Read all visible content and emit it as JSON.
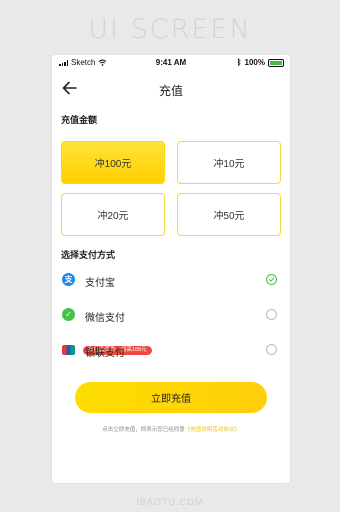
{
  "watermark": {
    "title": "UI SCREEN",
    "url": "IBAOTU.COM"
  },
  "status_bar": {
    "carrier": "Sketch",
    "time": "9:41 AM",
    "battery": "100%"
  },
  "nav": {
    "title": "充值"
  },
  "amount_section": {
    "label": "充值金额",
    "options": [
      {
        "label": "冲100元",
        "selected": true
      },
      {
        "label": "冲10元",
        "selected": false
      },
      {
        "label": "冲20元",
        "selected": false
      },
      {
        "label": "冲50元",
        "selected": false
      }
    ]
  },
  "payment_section": {
    "label": "选择支付方式",
    "methods": [
      {
        "label": "支付宝",
        "icon": "alipay-icon",
        "checked": true
      },
      {
        "label": "微信支付",
        "icon": "wechat-pay-icon",
        "checked": false
      },
      {
        "label": "银联支付",
        "icon": "unionpay-icon",
        "checked": false
      }
    ],
    "promo": "支付赢奖券，最高188元"
  },
  "submit": {
    "label": "立即充值"
  },
  "agreement": {
    "prefix": "点击立即充值，即表示您已经同意",
    "link": "《充值说明活动协议》"
  },
  "colors": {
    "accent": "#ffd600",
    "alipay": "#1e88e5",
    "wechat": "#46c24a",
    "promo": "#f0493f",
    "check": "#4cbb3f"
  }
}
